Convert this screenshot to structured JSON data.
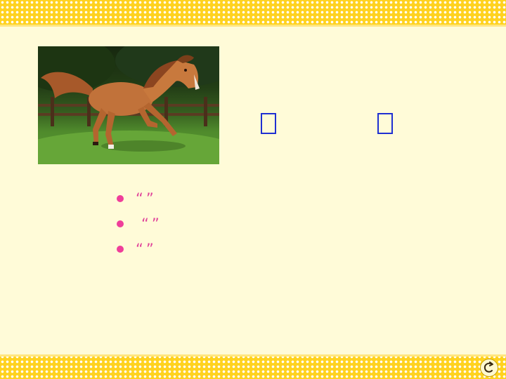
{
  "slide": {
    "title_glyphs": [
      "",
      ""
    ]
  },
  "bullets": [
    {
      "quote_open": "“",
      "term": "",
      "quote_close": "”",
      "text": ""
    },
    {
      "quote_open": "“",
      "term": "",
      "quote_close": "”",
      "text": ""
    },
    {
      "quote_open": "“",
      "term": "",
      "quote_close": "”",
      "text": ""
    }
  ],
  "colors": {
    "background": "#fffbd8",
    "band": "#ffd21f",
    "title_box": "#1f2fd1",
    "bullet_dot": "#ef3e9a",
    "term_text": "#e0439a",
    "body_text": "#2a8f2a"
  },
  "icons": {
    "nav": "return-arrow-icon",
    "bullet": "bullet-dot-icon"
  }
}
